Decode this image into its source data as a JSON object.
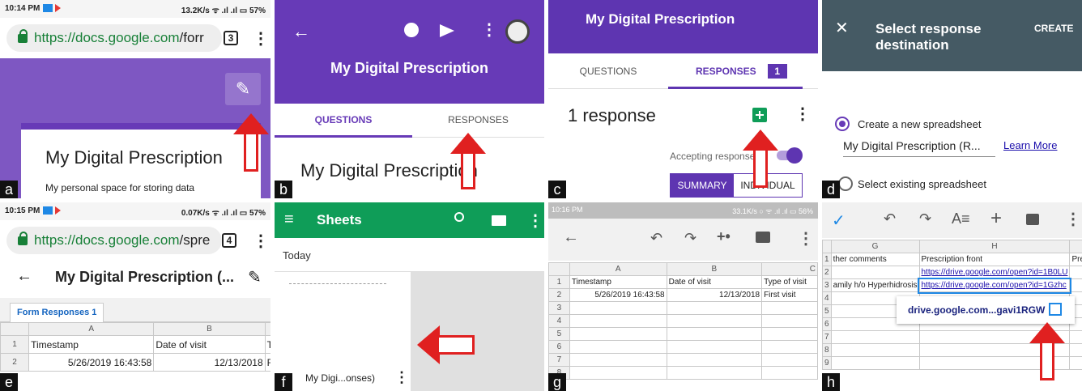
{
  "a": {
    "label": "a",
    "status_time": "10:14 PM",
    "status_right": "13.2K/s ᯤ .ıl .ıl ▭ 57%",
    "url_host": "https://docs.google.com",
    "url_path": "/forr",
    "tab_count": "3",
    "form_title": "My Digital Prescription",
    "form_desc": "My personal space for storing data"
  },
  "b": {
    "label": "b",
    "title": "My Digital Prescription",
    "tab_questions": "QUESTIONS",
    "tab_responses": "RESPONSES",
    "form_title": "My Digital Prescription"
  },
  "c": {
    "label": "c",
    "title": "My Digital Prescription",
    "tab_questions": "QUESTIONS",
    "tab_responses": "RESPONSES",
    "responses_badge": "1",
    "response_count": "1 response",
    "accepting": "Accepting responses",
    "summary": "SUMMARY",
    "individual": "INDIVIDUAL"
  },
  "d": {
    "label": "d",
    "title": "Select response destination",
    "create": "CREATE",
    "option_new": "Create a new spreadsheet",
    "sheet_name": "My Digital Prescription (R...",
    "learn_more": "Learn More",
    "option_existing": "Select existing spreadsheet"
  },
  "e": {
    "label": "e",
    "status_time": "10:15 PM",
    "status_right": "0.07K/s ᯤ .ıl .ıl ▭ 57%",
    "url_host": "https://docs.google.com",
    "url_path": "/spre",
    "tab_count": "4",
    "title": "My Digital Prescription (...",
    "sheet_tab": "Form Responses 1",
    "col_a": "A",
    "col_b": "B",
    "rows": [
      {
        "n": "1",
        "a": "Timestamp",
        "b": "Date of visit",
        "c": "T"
      },
      {
        "n": "2",
        "a": "5/26/2019 16:43:58",
        "b": "12/13/2018",
        "c": "F"
      }
    ]
  },
  "f": {
    "label": "f",
    "app_title": "Sheets",
    "today": "Today",
    "file_name": "My Digi...onses)"
  },
  "g": {
    "label": "g",
    "status_time": "10:16 PM",
    "status_right": "33.1K/s ○ ᯤ .ıl .ıl ▭ 56%",
    "cols": [
      "A",
      "B",
      "C"
    ],
    "rows": [
      {
        "n": "1",
        "a": "Timestamp",
        "b": "Date of visit",
        "c": "Type of visit"
      },
      {
        "n": "2",
        "a": "5/26/2019 16:43:58",
        "b": "12/13/2018",
        "c": "First visit"
      },
      {
        "n": "3",
        "a": "",
        "b": "",
        "c": ""
      },
      {
        "n": "4",
        "a": "",
        "b": "",
        "c": ""
      },
      {
        "n": "5",
        "a": "",
        "b": "",
        "c": ""
      },
      {
        "n": "6",
        "a": "",
        "b": "",
        "c": ""
      },
      {
        "n": "7",
        "a": "",
        "b": "",
        "c": ""
      },
      {
        "n": "8",
        "a": "",
        "b": "",
        "c": ""
      }
    ]
  },
  "h": {
    "label": "h",
    "cols": [
      "G",
      "H",
      "I"
    ],
    "rows": [
      {
        "n": "1",
        "g": "ther comments",
        "h": "Prescription front",
        "i": "Prescription b"
      },
      {
        "n": "2",
        "g": "",
        "h": "https://drive.google.com/open?id=1B0LU",
        "i": ""
      },
      {
        "n": "3",
        "g": "amily h/o Hyperhidrosis",
        "h": "https://drive.google.com/open?id=1Gzhc",
        "i": ""
      },
      {
        "n": "4",
        "g": "",
        "h": "",
        "i": ""
      },
      {
        "n": "5",
        "g": "",
        "h": "",
        "i": ""
      },
      {
        "n": "6",
        "g": "",
        "h": "",
        "i": ""
      },
      {
        "n": "7",
        "g": "",
        "h": "",
        "i": ""
      },
      {
        "n": "8",
        "g": "",
        "h": "",
        "i": ""
      },
      {
        "n": "9",
        "g": "",
        "h": "",
        "i": ""
      }
    ],
    "link_popup": "drive.google.com...gavi1RGW"
  },
  "colors": {
    "forms_purple": "#673ab7",
    "forms_dark_purple": "#5e35b1",
    "sheets_green": "#0f9d58",
    "dark_header": "#455a64",
    "arrow_red": "#e02020"
  }
}
